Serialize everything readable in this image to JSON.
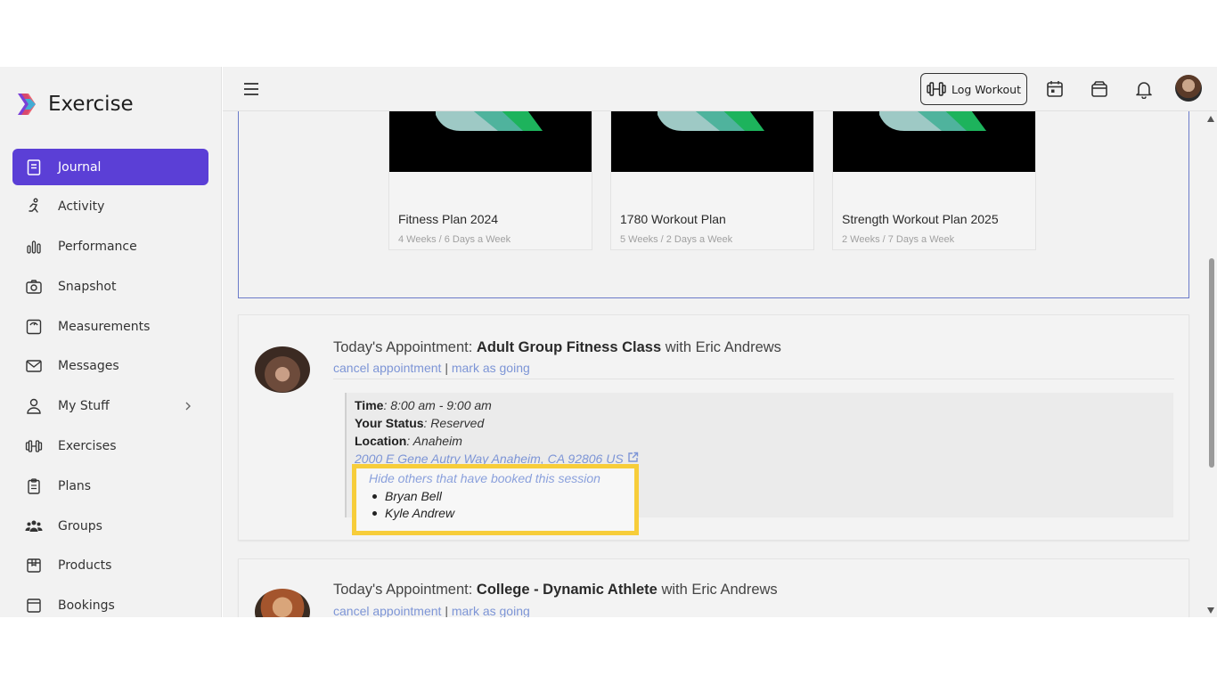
{
  "app": {
    "title": "Exercise"
  },
  "sidebar": {
    "items": [
      {
        "label": "Journal",
        "icon": "journal-icon",
        "active": true
      },
      {
        "label": "Activity",
        "icon": "running-icon"
      },
      {
        "label": "Performance",
        "icon": "bar-chart-icon"
      },
      {
        "label": "Snapshot",
        "icon": "camera-icon"
      },
      {
        "label": "Measurements",
        "icon": "scale-icon"
      },
      {
        "label": "Messages",
        "icon": "envelope-icon"
      },
      {
        "label": "My Stuff",
        "icon": "user-icon",
        "has_chevron": true
      },
      {
        "label": "Exercises",
        "icon": "dumbbell-icon"
      },
      {
        "label": "Plans",
        "icon": "clipboard-icon"
      },
      {
        "label": "Groups",
        "icon": "group-icon"
      },
      {
        "label": "Products",
        "icon": "box-icon"
      },
      {
        "label": "Bookings",
        "icon": "booking-icon"
      }
    ]
  },
  "topbar": {
    "log_workout_label": "Log Workout"
  },
  "plans": [
    {
      "title": "Fitness Plan 2024",
      "subtitle": "4 Weeks / 6 Days a Week"
    },
    {
      "title": "1780 Workout Plan",
      "subtitle": "5 Weeks / 2 Days a Week"
    },
    {
      "title": "Strength Workout Plan 2025",
      "subtitle": "2 Weeks / 7 Days a Week"
    }
  ],
  "appointments": [
    {
      "prefix": "Today's Appointment: ",
      "class_name": "Adult Group Fitness Class",
      "with_text": " with Eric Andrews",
      "cancel_label": "cancel appointment",
      "separator": "|",
      "going_label": "mark as going",
      "time_label": "Time",
      "time_value": ": 8:00 am - 9:00 am",
      "status_label": "Your Status",
      "status_value": ": Reserved",
      "location_label": "Location",
      "location_value": ": Anaheim",
      "address": "2000 E Gene Autry Way Anaheim, CA 92806 US",
      "hide_others_label": "Hide others that have booked this session",
      "booked": [
        "Bryan Bell",
        "Kyle Andrew"
      ]
    },
    {
      "prefix": "Today's Appointment: ",
      "class_name": "College - Dynamic Athlete",
      "with_text": " with Eric Andrews",
      "cancel_label": "cancel appointment",
      "separator": "|",
      "going_label": "mark as going"
    }
  ],
  "colors": {
    "accent": "#5b3fd6",
    "link": "#7d95d6",
    "highlight": "#f7cd3a"
  }
}
